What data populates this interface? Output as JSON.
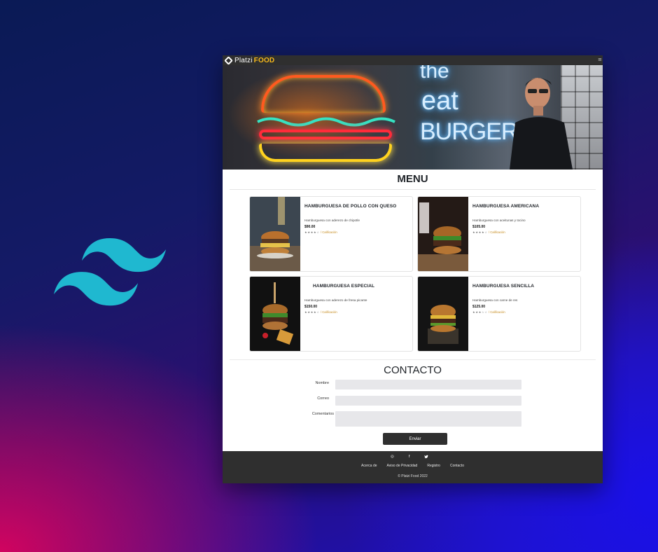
{
  "brand": {
    "name_part1": "Platzi",
    "name_part2": "FOOD"
  },
  "hero": {
    "neon_words": [
      "the",
      "eat",
      "BURGER"
    ]
  },
  "menu": {
    "title": "MENU",
    "items": [
      {
        "name": "HAMBURGUESA DE POLLO CON QUESO",
        "description": "Hamburguesa con aderezo de chipotle",
        "price": "$90.00",
        "stars": "★★★★☆",
        "rating_label": "/ Calificación"
      },
      {
        "name": "HAMBURGUESA AMERICANA",
        "description": "Hamburguesa con aceitunas y tocino",
        "price": "$105.00",
        "stars": "★★★★☆",
        "rating_label": "/ Calificación"
      },
      {
        "name": "HAMBURGUESA ESPECIAL",
        "description": "Hamburguesa con aderezo de fresa picante",
        "price": "$150.00",
        "stars": "★★★★☆",
        "rating_label": "/ Calificación"
      },
      {
        "name": "HAMBURGUESA SENCILLA",
        "description": "Hamburguesa con carne de res",
        "price": "$125.00",
        "stars": "★★★☆☆",
        "rating_label": "/ Calificación"
      }
    ]
  },
  "contact": {
    "title": "CONTACTO",
    "name_label": "Nombre",
    "email_label": "Correo",
    "comments_label": "Comentarios",
    "name_value": "",
    "email_value": "",
    "comments_value": "",
    "submit_label": "Enviar"
  },
  "footer": {
    "social_icons": [
      "instagram-icon",
      "facebook-icon",
      "twitter-icon"
    ],
    "social_glyphs": [
      "◎",
      "f",
      "🐦"
    ],
    "links": [
      "Acerca de",
      "Aviso de Privacidad",
      "Registro",
      "Contacto"
    ],
    "copyright": "© Platzi Food 2022"
  },
  "colors": {
    "accent": "#f6b81b",
    "dark": "#2f2f2f",
    "tailwind": "#38bdf8"
  }
}
